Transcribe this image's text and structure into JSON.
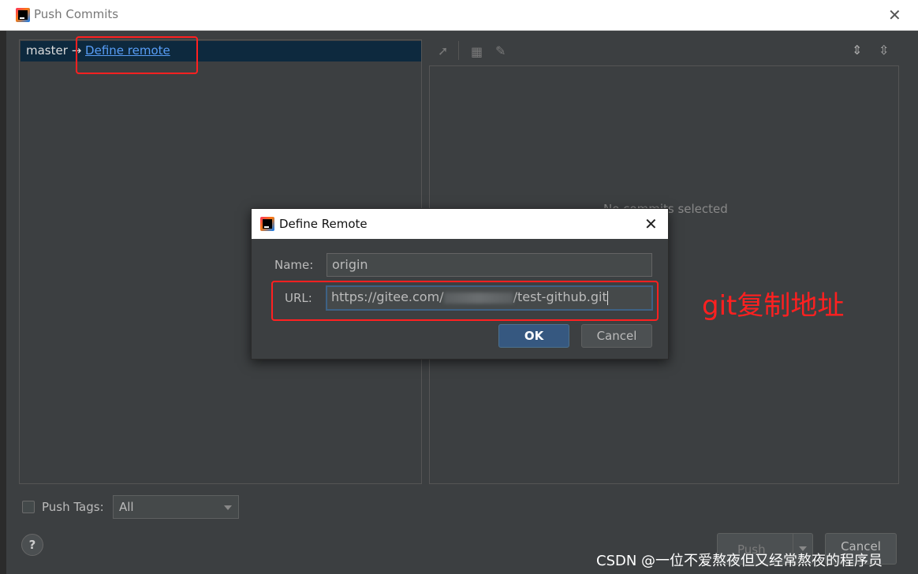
{
  "window": {
    "title": "Push Commits"
  },
  "branch": {
    "name": "master",
    "arrow": "→",
    "link": "Define remote"
  },
  "details": {
    "empty_text": "No commits selected"
  },
  "footer": {
    "push_tags_label": "Push Tags:",
    "tags_select_value": "All",
    "help": "?",
    "push_button": "Push",
    "cancel_button": "Cancel"
  },
  "dialog": {
    "title": "Define Remote",
    "name_label": "Name:",
    "name_value": "origin",
    "url_label": "URL:",
    "url_prefix": "https://gitee.com/",
    "url_suffix": "/test-github.git",
    "ok_button": "OK",
    "cancel_button": "Cancel"
  },
  "annotation": "git复制地址",
  "watermark": "CSDN @一位不爱熬夜但又经常熬夜的程序员",
  "colors": {
    "background": "#3c3f41",
    "link": "#589df6",
    "highlight_red": "#ff2020",
    "selection": "#0d293e",
    "ok_button": "#365880"
  }
}
